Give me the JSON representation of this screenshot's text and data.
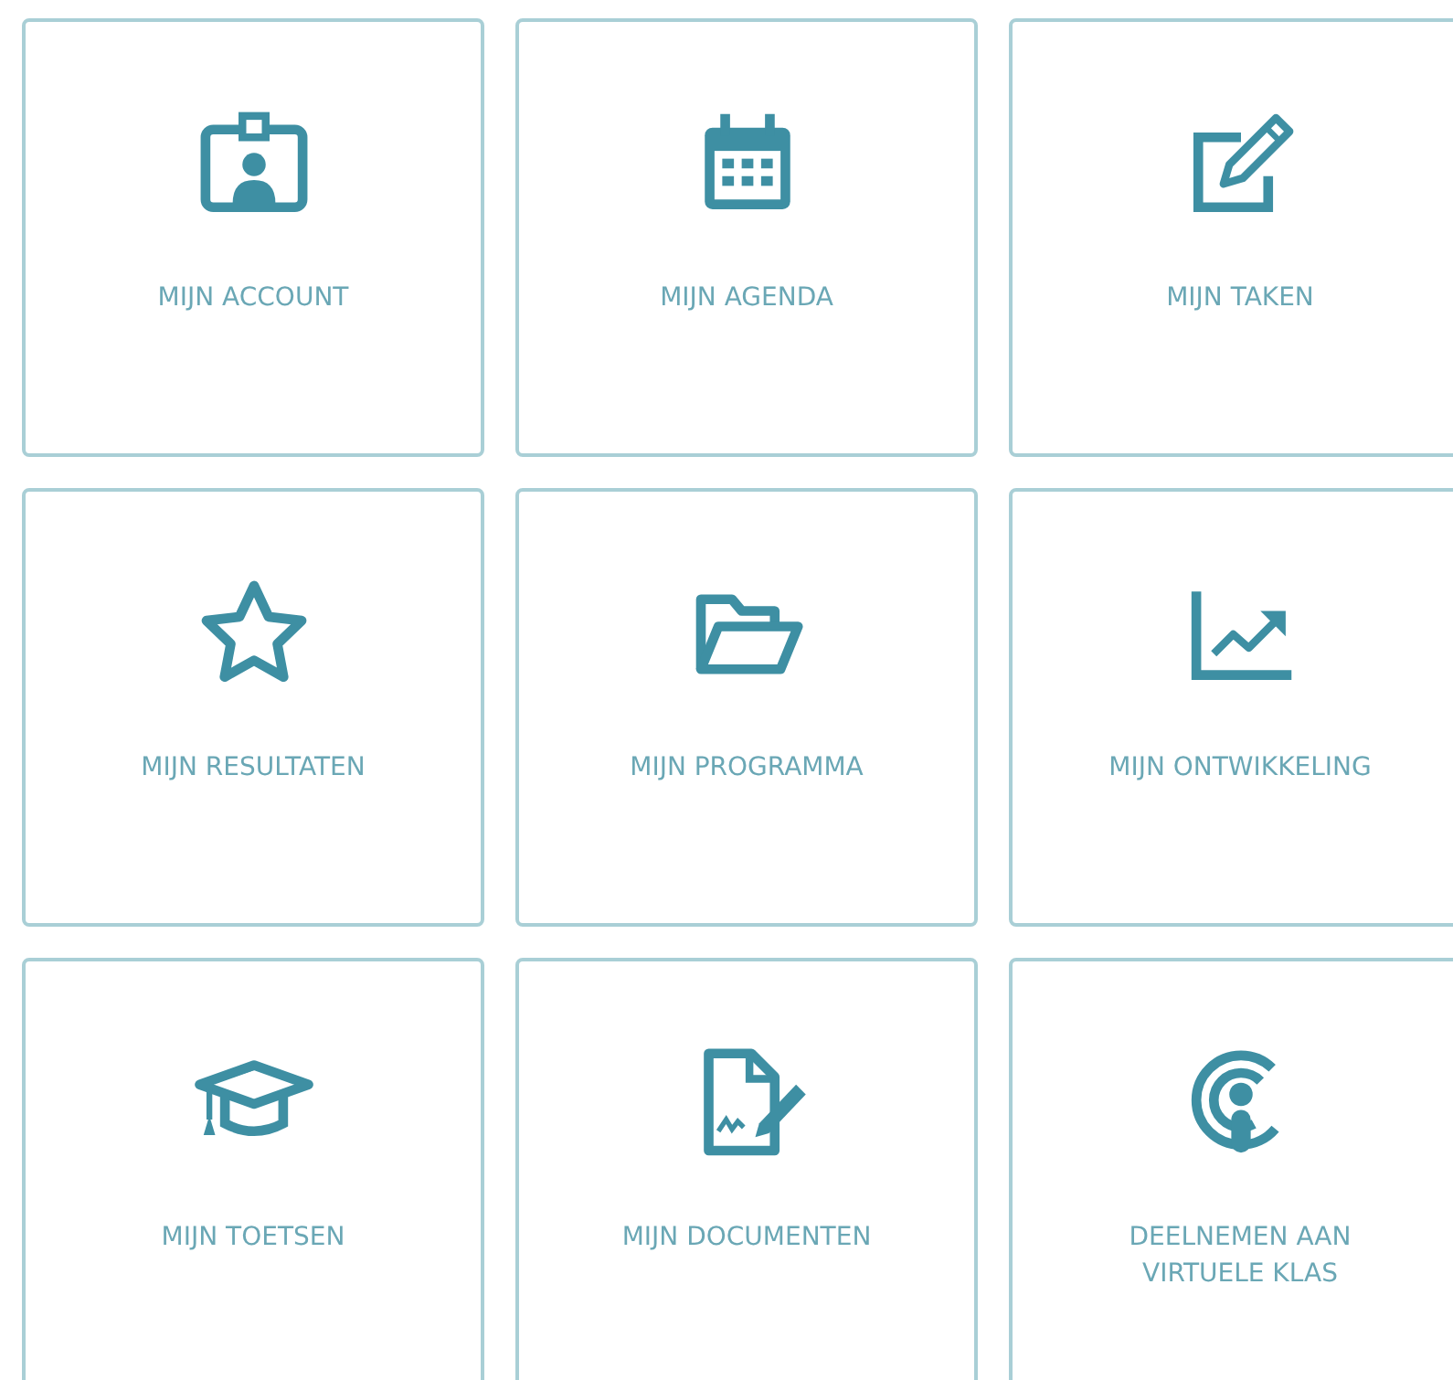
{
  "tiles": [
    {
      "kind": "account",
      "label": "MIJN ACCOUNT"
    },
    {
      "kind": "agenda",
      "label": "MIJN AGENDA"
    },
    {
      "kind": "tasks",
      "label": "MIJN TAKEN"
    },
    {
      "kind": "results",
      "label": "MIJN RESULTATEN"
    },
    {
      "kind": "program",
      "label": "MIJN PROGRAMMA"
    },
    {
      "kind": "development",
      "label": "MIJN ONTWIKKELING"
    },
    {
      "kind": "tests",
      "label": "MIJN TOETSEN"
    },
    {
      "kind": "documents",
      "label": "MIJN DOCUMENTEN"
    },
    {
      "kind": "virtual_class",
      "label": "DEELNEMEN AAN\nVIRTUELE KLAS"
    }
  ]
}
